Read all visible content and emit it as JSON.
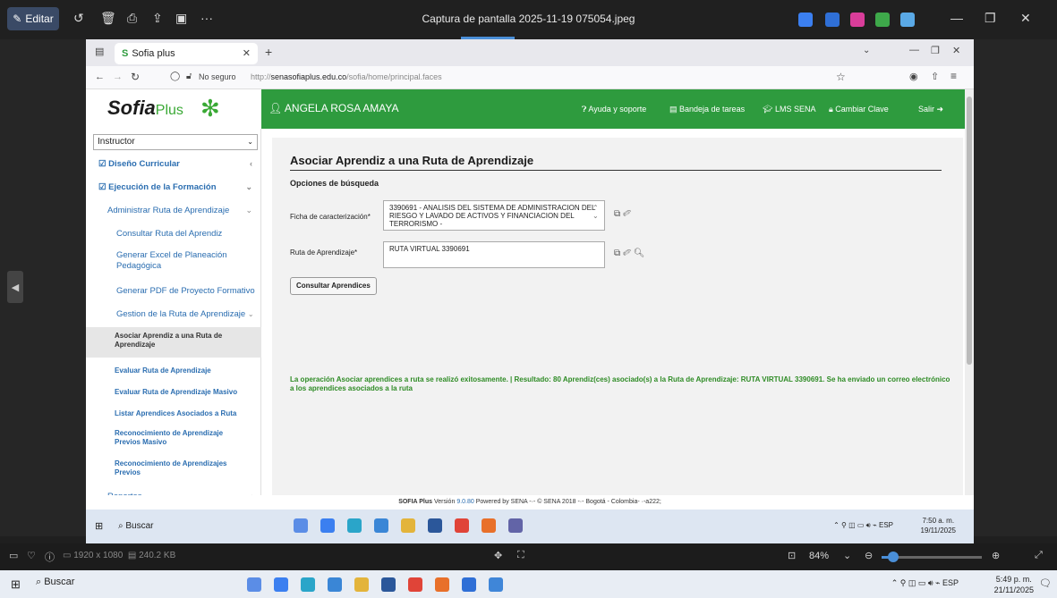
{
  "viewer": {
    "edit_label": "Editar",
    "title": "Captura de pantalla 2025-11-19 075054.jpeg",
    "info_dims": "1920 x 1080",
    "info_size": "240.2 KB",
    "zoom": "84%",
    "zoom_fraction": 0.12
  },
  "browser": {
    "tab_title": "Sofia plus",
    "not_secure": "No seguro",
    "url_prefix": "http://",
    "url_host": "senasofiaplus.edu.co",
    "url_path": "/sofia/home/principal.faces"
  },
  "header": {
    "logo_main": "Sofia",
    "logo_plus": "Plus",
    "user": "ANGELA ROSA AMAYA",
    "help": "Ayuda y soporte",
    "tasks": "Bandeja de tareas",
    "lms": "LMS SENA",
    "change_pwd": "Cambiar Clave",
    "logout": "Salir"
  },
  "sidebar": {
    "role": "Instructor",
    "items": [
      {
        "label": "Diseño Curricular"
      },
      {
        "label": "Ejecución de la Formación"
      },
      {
        "label": "Administrar Ruta de Aprendizaje"
      },
      {
        "label": "Consultar Ruta del Aprendiz"
      },
      {
        "label": "Generar Excel de Planeación Pedagógica"
      },
      {
        "label": "Generar PDF de Proyecto Formativo"
      },
      {
        "label": "Gestion de la Ruta de Aprendizaje"
      },
      {
        "label": "Asociar Aprendiz a una Ruta de Aprendizaje"
      },
      {
        "label": "Evaluar Ruta de Aprendizaje"
      },
      {
        "label": "Evaluar Ruta de Aprendizaje Masivo"
      },
      {
        "label": "Listar Aprendices Asociados a Ruta"
      },
      {
        "label": "Reconocimiento de Aprendizaje Previos Masivo"
      },
      {
        "label": "Reconocimiento de Aprendizajes Previos"
      },
      {
        "label": "Reportes"
      }
    ]
  },
  "main": {
    "title": "Asociar Aprendiz a una Ruta de Aprendizaje",
    "search_options": "Opciones de búsqueda",
    "ficha_label": "Ficha de caracterización*",
    "ficha_value": "3390691 - ANALISIS DEL SISTEMA DE ADMINISTRACION DEL RIESGO Y LAVADO DE ACTIVOS Y FINANCIACION DEL TERRORISMO -",
    "ruta_label": "Ruta de Aprendizaje*",
    "ruta_value": "RUTA VIRTUAL 3390691",
    "consult_button": "Consultar Aprendices",
    "success_message": "La operación Asociar aprendices a ruta se realizó exitosamente. | Resultado: 80 Aprendiz(ces) asociado(s) a la Ruta de Aprendizaje: RUTA VIRTUAL 3390691. Se ha enviado un correo electrónico a los aprendices asociados a la ruta"
  },
  "footer": {
    "brand": "SOFIA Plus",
    "version_prefix": "Versión",
    "version": "9.0.80",
    "rest": "Powered by SENA -·- © SENA 2018 -·- Bogotá - Colombia- ·-a222;"
  },
  "inner_taskbar": {
    "search": "Buscar",
    "lang": "ESP",
    "time": "7:50 a. m.",
    "date": "19/11/2025"
  },
  "taskbar": {
    "search": "Buscar",
    "lang": "ESP",
    "time": "5:49 p. m.",
    "date": "21/11/2025"
  }
}
